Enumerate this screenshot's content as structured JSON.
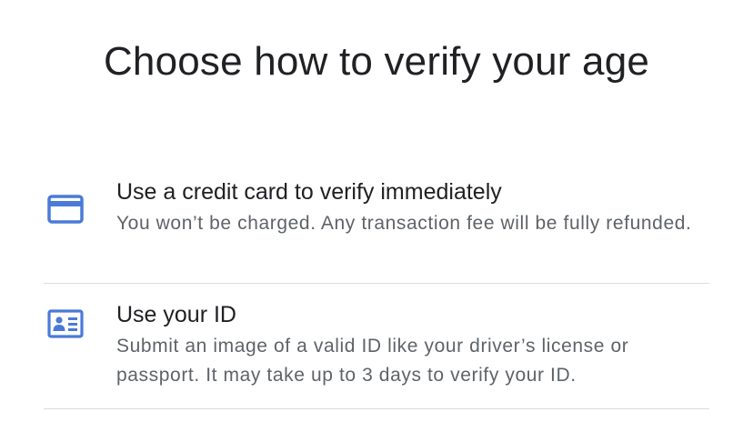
{
  "page": {
    "title": "Choose how to verify your age"
  },
  "options": [
    {
      "icon": "credit-card-icon",
      "title": "Use a credit card to verify immediately",
      "description": "You won’t be charged. Any transaction fee will be fully refunded."
    },
    {
      "icon": "id-card-icon",
      "title": "Use your ID",
      "description": "Submit an image of a valid ID like your driver’s license or passport. It may take up to 3 days to verify your ID."
    }
  ],
  "colors": {
    "icon_blue": "#4a7ad8",
    "text_primary": "#202124",
    "text_secondary": "#5f6368",
    "divider": "#dadce0"
  }
}
